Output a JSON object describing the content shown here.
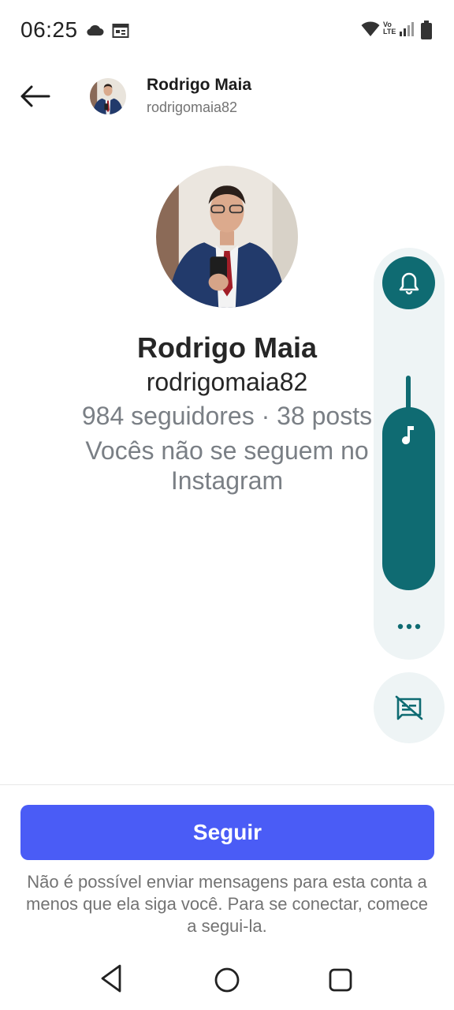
{
  "status_bar": {
    "time": "06:25",
    "icons": [
      "cloud-icon",
      "calendar-icon",
      "wifi-icon",
      "volte-icon",
      "signal-icon",
      "battery-icon"
    ],
    "volte_label_top": "Vo",
    "volte_label_bottom": "LTE"
  },
  "header": {
    "name": "Rodrigo Maia",
    "username": "rodrigomaia82"
  },
  "profile": {
    "name": "Rodrigo Maia",
    "username": "rodrigomaia82",
    "stats": "984 seguidores · 38 posts",
    "note": "Vocês não se seguem no Instagram"
  },
  "volume_panel": {
    "ringer_mode": "bell-icon",
    "media_icon": "music-note-icon",
    "level": 0.88,
    "accent_color": "#0f6b72",
    "panel_background": "#eef4f5"
  },
  "actions": {
    "follow_label": "Seguir",
    "follow_color": "#4a5cf6",
    "notice": "Não é possível enviar mensagens para esta conta a menos que ela siga você. Para se conectar, comece a segui-la."
  },
  "nav": {
    "icons": [
      "nav-back-icon",
      "nav-home-icon",
      "nav-recents-icon"
    ]
  }
}
